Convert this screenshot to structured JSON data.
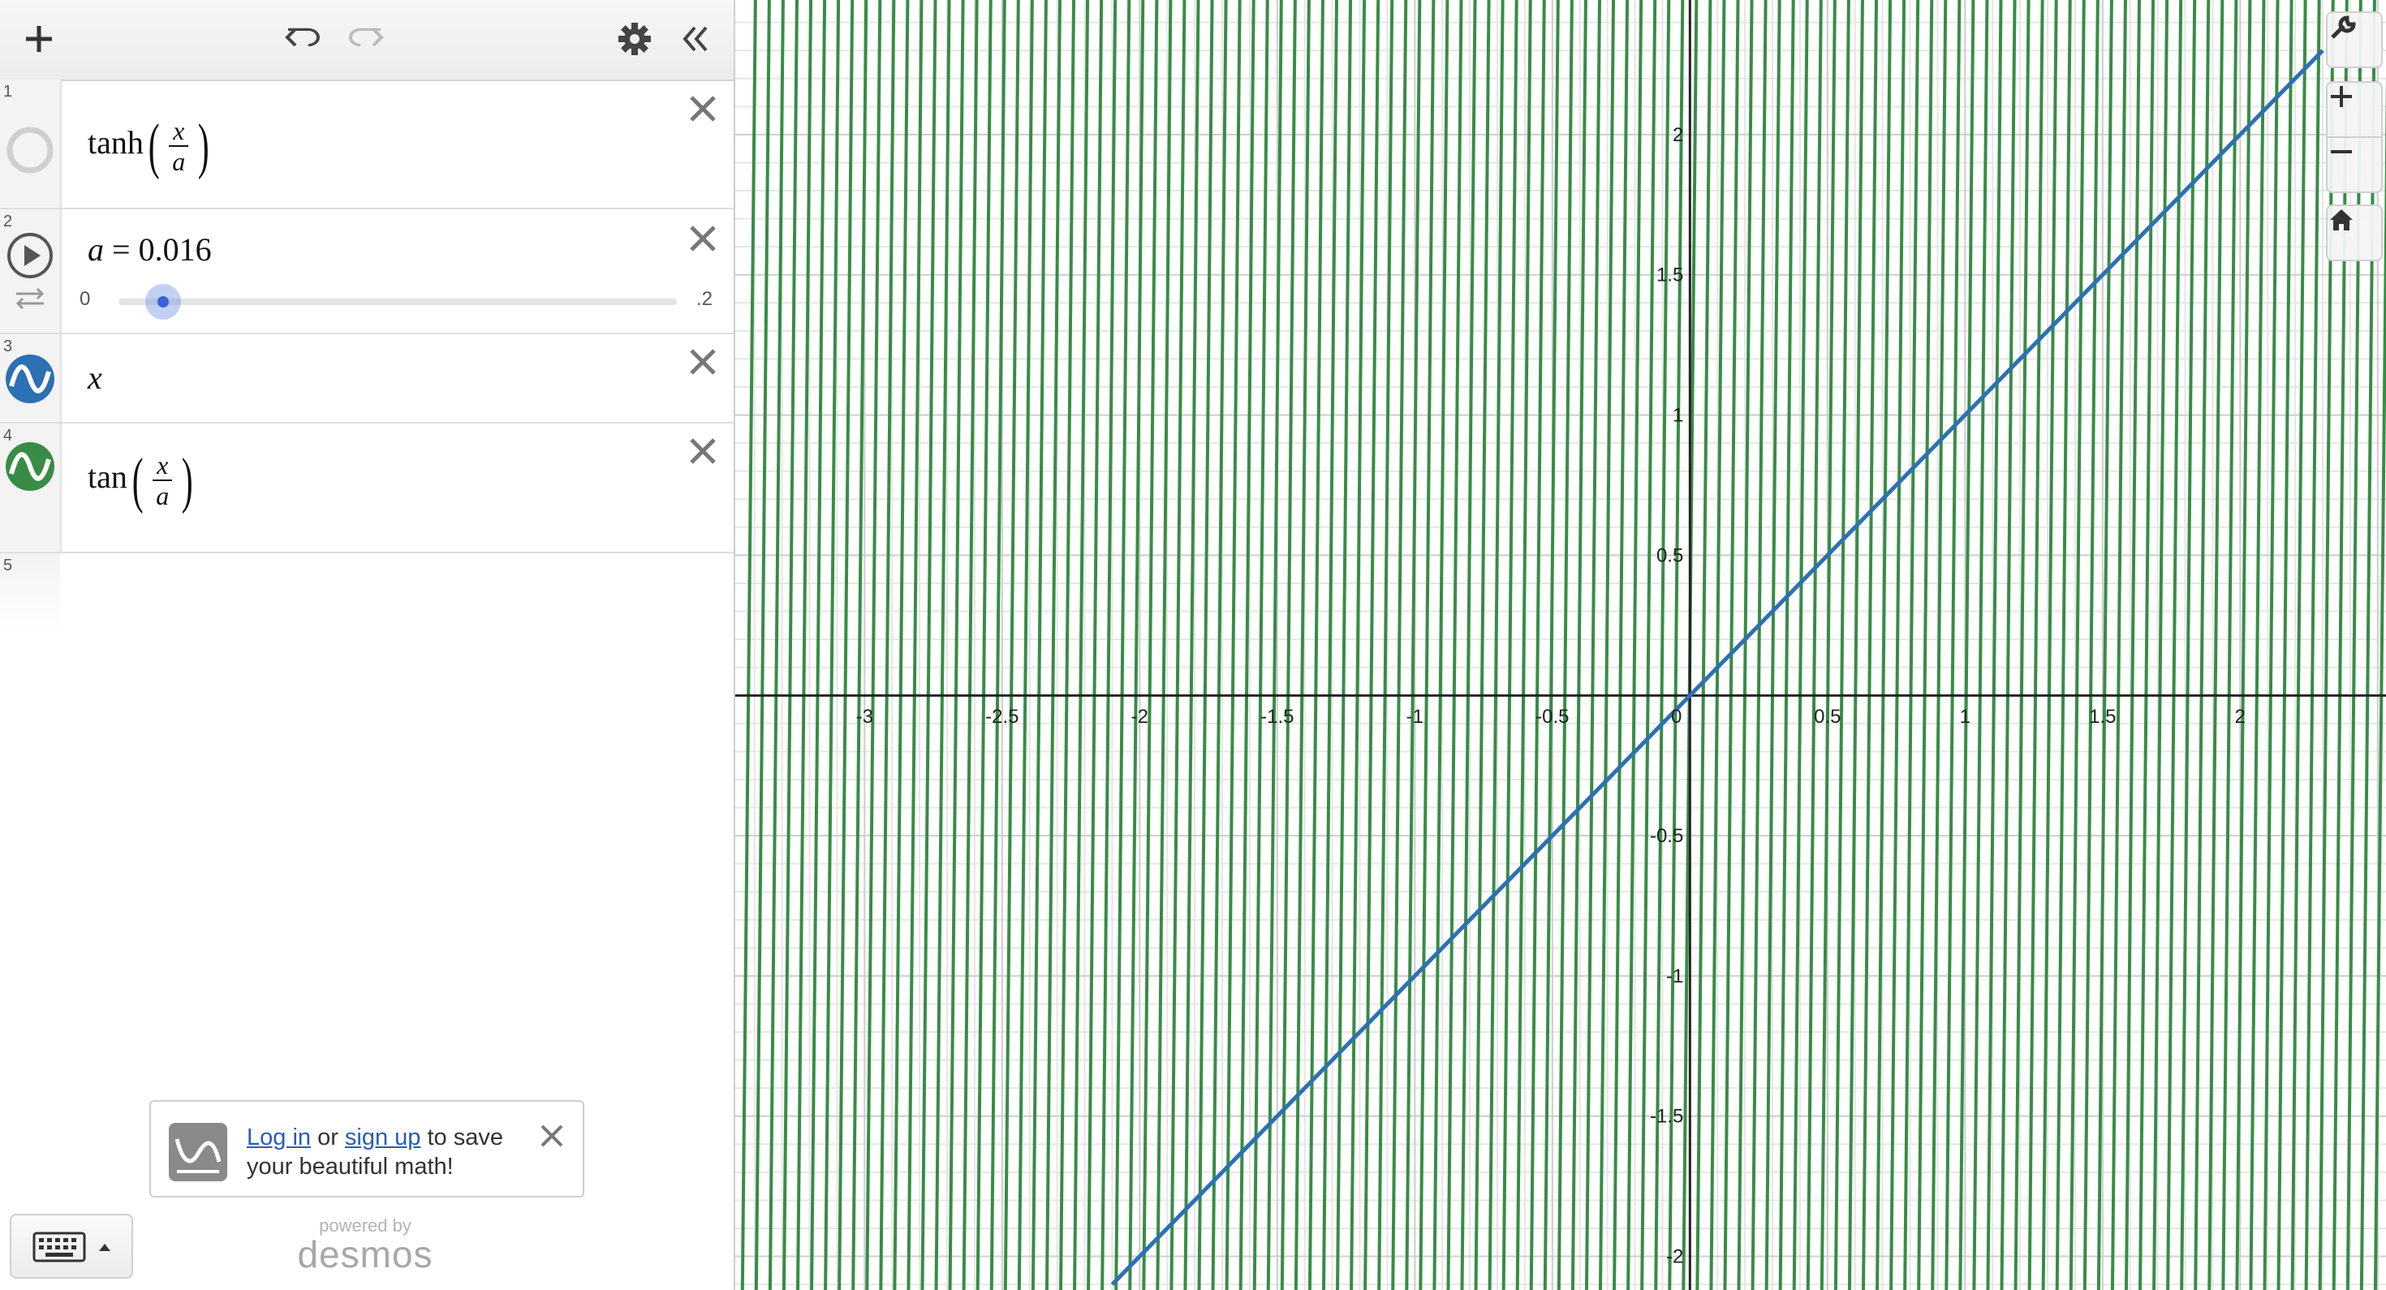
{
  "toolbar": {
    "add": "add-icon",
    "undo": "undo-icon",
    "redo": "redo-icon",
    "settings": "gear-icon",
    "collapse": "collapse-icon"
  },
  "expressions": [
    {
      "index": "1",
      "func": "tanh",
      "num": "x",
      "den": "a",
      "icon": "hidden-circle-icon"
    },
    {
      "index": "2",
      "var": "a",
      "eq": " = ",
      "value": "0.016",
      "slider_min": "0",
      "slider_max": ".2",
      "slider_fraction": 0.08,
      "icon": "play-icon"
    },
    {
      "index": "3",
      "text": "x",
      "icon": "wave-icon",
      "color": "#2d70b3"
    },
    {
      "index": "4",
      "func": "tan",
      "num": "x",
      "den": "a",
      "icon": "wave-icon",
      "color": "#388c46"
    },
    {
      "index": "5"
    }
  ],
  "banner": {
    "login": "Log in",
    "or": " or ",
    "signup": "sign up",
    "rest": " to save your beautiful math!"
  },
  "powered": {
    "by": "powered by",
    "name": "desmos"
  },
  "graph": {
    "x_ticks": [
      "-3",
      "-2.5",
      "-2",
      "-1.5",
      "-1",
      "-0.5",
      "0",
      "0.5",
      "1",
      "1.5",
      "2"
    ],
    "y_ticks": [
      "2",
      "1.5",
      "1",
      "0.5",
      "-0.5",
      "-1",
      "-1.5",
      "-2"
    ],
    "colors": {
      "line": "#2d70b3",
      "tan": "#388c46",
      "axis": "#222222",
      "grid": "#e6e6e6"
    }
  },
  "chart_data": {
    "type": "line",
    "series": [
      {
        "name": "x",
        "x": [
          -2.1,
          2.3
        ],
        "y": [
          -2.1,
          2.3
        ]
      },
      {
        "name": "tan(x/a)",
        "asymptote_spacing": 0.0503
      }
    ],
    "xlim": [
      -3.47,
      2.53
    ],
    "ylim": [
      -2.12,
      2.48
    ],
    "grid": true
  },
  "graph_controls": [
    "wrench-icon",
    "zoom-in-icon",
    "zoom-out-icon",
    "home-icon"
  ]
}
